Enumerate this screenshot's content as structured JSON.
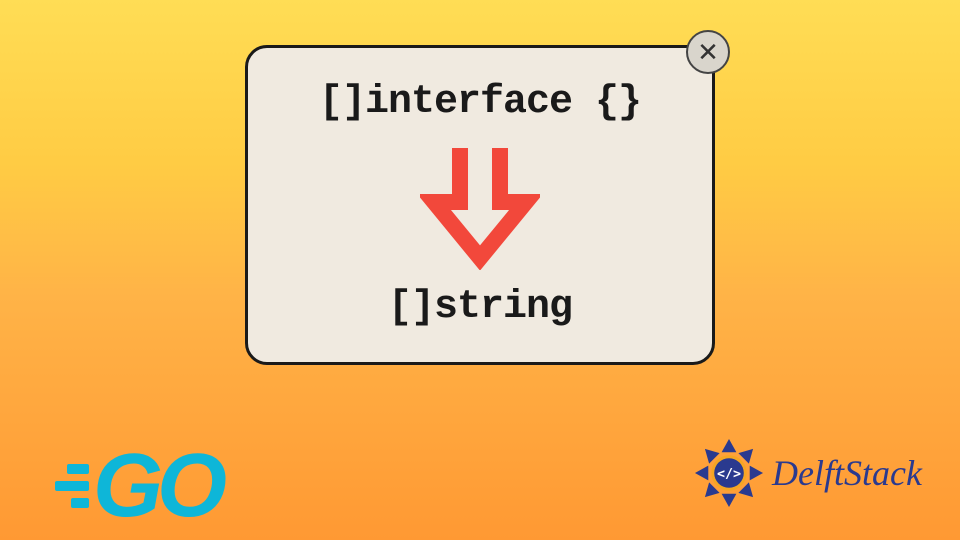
{
  "card": {
    "top_code": "[]interface {}",
    "bottom_code": "[]string",
    "close_symbol": "✕"
  },
  "arrow": {
    "color": "#f2483b"
  },
  "logos": {
    "go_text": "GO",
    "go_color": "#0eb6d8",
    "delftstack_text": "DelftStack",
    "delftstack_color": "#2a3a8f"
  }
}
